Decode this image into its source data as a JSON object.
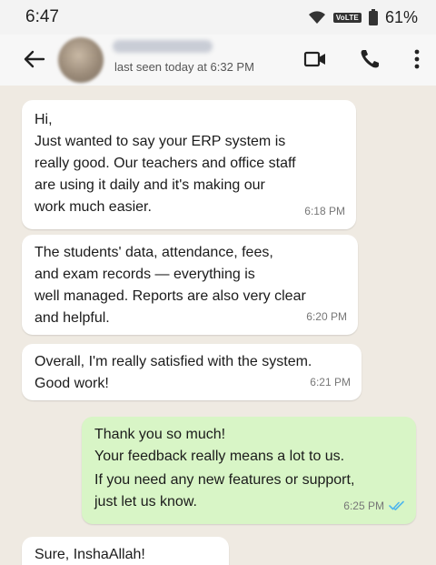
{
  "status_bar": {
    "time": "6:47",
    "volte": "VoLTE",
    "battery": "61%"
  },
  "header": {
    "last_seen": "last seen today at 6:32 PM"
  },
  "messages": [
    {
      "direction": "incoming",
      "lines": [
        "Hi,",
        "Just wanted to say your ERP system is",
        "really good. Our teachers and office staff",
        "are using it daily and it's making our",
        "work much easier."
      ],
      "time": "6:18 PM"
    },
    {
      "direction": "incoming",
      "lines": [
        "The students' data, attendance, fees,",
        "and exam records — everything is",
        "well managed. Reports are also very clear",
        "and helpful."
      ],
      "time": "6:20 PM"
    },
    {
      "direction": "incoming",
      "lines": [
        "Overall, I'm really satisfied with the system.",
        "Good work!"
      ],
      "time": "6:21 PM"
    },
    {
      "direction": "outgoing",
      "lines": [
        "Thank you so much!",
        "Your feedback really means a lot to us.",
        "If you need any new features or support,",
        "just let us know."
      ],
      "time": "6:25 PM"
    },
    {
      "direction": "incoming",
      "lines": [
        "Sure, InshaAllah!"
      ],
      "time": ""
    }
  ],
  "colors": {
    "chat_background": "#efeae2",
    "incoming_bubble": "#ffffff",
    "outgoing_bubble": "#d8f5c6",
    "read_ticks": "#4fb6ec"
  }
}
